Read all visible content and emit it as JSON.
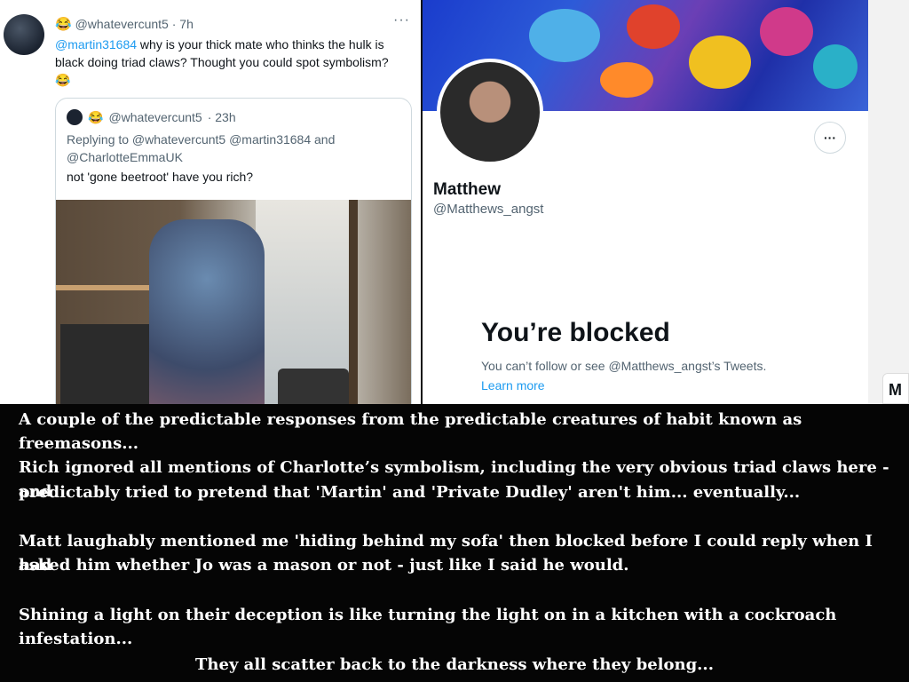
{
  "left_tweet": {
    "emoji": "😂",
    "handle": "@whatevercunt5",
    "time": "· 7h",
    "more": "···",
    "mention": "@martin31684",
    "text": " why is your thick mate who thinks the hulk is black doing triad claws? Thought you could spot symbolism?",
    "trailing_emoji": "😂",
    "quote": {
      "emoji": "😂",
      "handle": "@whatevercunt5",
      "time": "· 23h",
      "replying": "Replying to @whatevercunt5 @martin31684 and @CharlotteEmmaUK",
      "text": "not 'gone beetroot' have you rich?"
    }
  },
  "right_profile": {
    "name": "Matthew",
    "handle": "@Matthews_angst",
    "more": "···",
    "blocked_title": "You’re blocked",
    "blocked_sub": "You can’t follow or see @Matthews_angst’s Tweets.",
    "learn_more": "Learn more",
    "edge_letter": "M"
  },
  "caption": {
    "line1": "A couple of the predictable responses from the predictable creatures of habit known as freemasons...",
    "line2": "Rich ignored all mentions of Charlotte’s symbolism, including the very obvious triad claws here - and",
    "line3": "predictably tried to pretend that 'Martin' and 'Private Dudley' aren't him... eventually...",
    "line4": "Matt laughably mentioned me 'hiding behind my sofa' then blocked before I could reply when I had",
    "line5": "asked him whether Jo was a mason or not - just like I said he would.",
    "line6": "Shining a light on their deception is like turning the light on in a kitchen with a cockroach infestation...",
    "line7": "They all scatter back to the darkness where they belong..."
  }
}
